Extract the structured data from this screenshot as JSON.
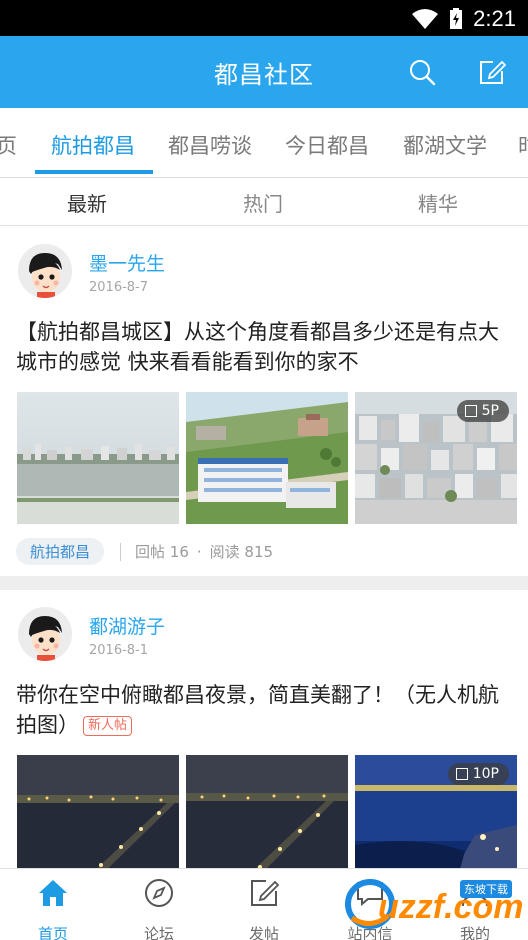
{
  "status_bar": {
    "time": "2:21"
  },
  "app_bar": {
    "title": "都昌社区"
  },
  "category_tabs": [
    "页",
    "航拍都昌",
    "都昌唠谈",
    "今日都昌",
    "鄱湖文学",
    "时"
  ],
  "sort_tabs": [
    "最新",
    "热门",
    "精华"
  ],
  "posts": [
    {
      "author": "墨一先生",
      "date": "2016-8-7",
      "title": "【航拍都昌城区】从这个角度看都昌多少还是有点大城市的感觉 快来看看能看到你的家不",
      "image_count": "5P",
      "forum_tag": "航拍都昌",
      "replies": "回帖 16",
      "views": "阅读 815"
    },
    {
      "author": "鄱湖游子",
      "date": "2016-8-1",
      "title": "带你在空中俯瞰都昌夜景，简直美翻了！（无人机航拍图）",
      "new_tag": "新人帖",
      "image_count": "10P"
    }
  ],
  "bottom_nav": [
    {
      "label": "首页",
      "icon": "home-icon",
      "active": true
    },
    {
      "label": "论坛",
      "icon": "compass-icon"
    },
    {
      "label": "发帖",
      "icon": "compose-icon"
    },
    {
      "label": "站内信",
      "icon": "message-icon"
    },
    {
      "label": "我的",
      "icon": "profile-icon"
    }
  ],
  "watermark": {
    "text": "uzzf.com",
    "tag": "东坡下载"
  },
  "colors": {
    "primary": "#29a6ee",
    "accent_tab": "#1d9be3",
    "new_tag": "#f06a5a",
    "watermark": "#ff8a00"
  }
}
